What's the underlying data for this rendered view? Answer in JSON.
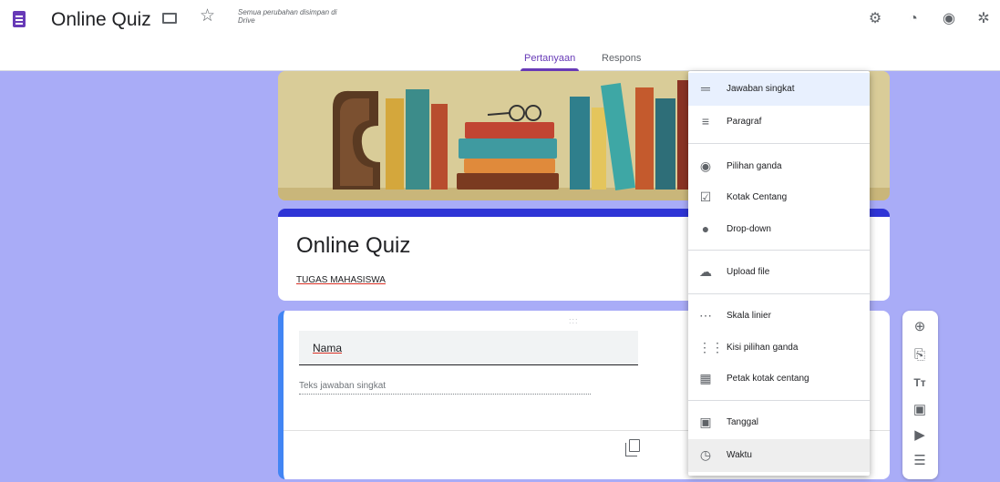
{
  "header": {
    "app_title": "Online Quiz",
    "save_status": "Semua perubahan disimpan di Drive",
    "icons": [
      "doc-icon",
      "folder-icon",
      "star-icon",
      "addon-icon",
      "palette-icon",
      "eye-icon",
      "gear-icon"
    ]
  },
  "tabs": [
    {
      "label": "Pertanyaan",
      "active": true
    },
    {
      "label": "Respons",
      "active": false
    }
  ],
  "form": {
    "title": "Online Quiz",
    "description": "TUGAS MAHASISWA"
  },
  "question": {
    "title": "Nama",
    "answer_placeholder": "Teks jawaban singkat",
    "drag_handle": ":::"
  },
  "type_menu": {
    "items": [
      {
        "label": "Jawaban singkat",
        "icon": "short-answer-icon",
        "selected": true
      },
      {
        "label": "Paragraf",
        "icon": "paragraph-icon"
      },
      {
        "label": "Pilihan ganda",
        "icon": "radio-icon"
      },
      {
        "label": "Kotak Centang",
        "icon": "checkbox-icon"
      },
      {
        "label": "Drop-down",
        "icon": "dropdown-icon"
      },
      {
        "label": "Upload file",
        "icon": "cloud-upload-icon"
      },
      {
        "label": "Skala linier",
        "icon": "linear-scale-icon"
      },
      {
        "label": "Kisi pilihan ganda",
        "icon": "grid-icon"
      },
      {
        "label": "Petak kotak centang",
        "icon": "checkbox-grid-icon"
      },
      {
        "label": "Tanggal",
        "icon": "calendar-icon"
      },
      {
        "label": "Waktu",
        "icon": "clock-icon",
        "hovered": true
      }
    ]
  },
  "side_toolbar": {
    "icons": [
      "add-question-icon",
      "import-questions-icon",
      "add-title-icon",
      "add-image-icon",
      "add-video-icon",
      "add-section-icon"
    ]
  },
  "colors": {
    "accent": "#673ab7",
    "canvas_bg": "#a9acf7",
    "title_card_border": "#2f35d6",
    "selected_item_bg": "#e8f0fe"
  }
}
